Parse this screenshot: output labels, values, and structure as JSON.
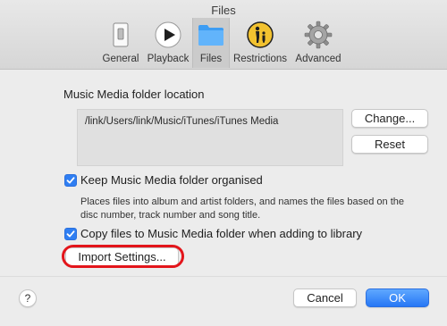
{
  "window": {
    "title": "Files"
  },
  "tabs": [
    {
      "label": "General",
      "icon": "general-switch-icon"
    },
    {
      "label": "Playback",
      "icon": "play-icon"
    },
    {
      "label": "Files",
      "icon": "folder-icon",
      "selected": true
    },
    {
      "label": "Restrictions",
      "icon": "parental-restrictions-icon"
    },
    {
      "label": "Advanced",
      "icon": "gear-icon"
    }
  ],
  "folder_location": {
    "label": "Music Media folder location",
    "path": "/link/Users/link/Music/iTunes/iTunes Media",
    "change_button": "Change...",
    "reset_button": "Reset"
  },
  "options": {
    "keep_organised": {
      "label": "Keep Music Media folder organised",
      "checked": true,
      "description": "Places files into album and artist folders, and names the files based on the disc number, track number and song title."
    },
    "copy_files": {
      "label": "Copy files to Music Media folder when adding to library",
      "checked": true
    }
  },
  "import_button": "Import Settings...",
  "footer": {
    "help": "?",
    "cancel_button": "Cancel",
    "ok_button": "OK"
  },
  "colors": {
    "accent": "#2f7ef2",
    "highlight_annotation": "#e3151b",
    "background": "#ececec"
  }
}
